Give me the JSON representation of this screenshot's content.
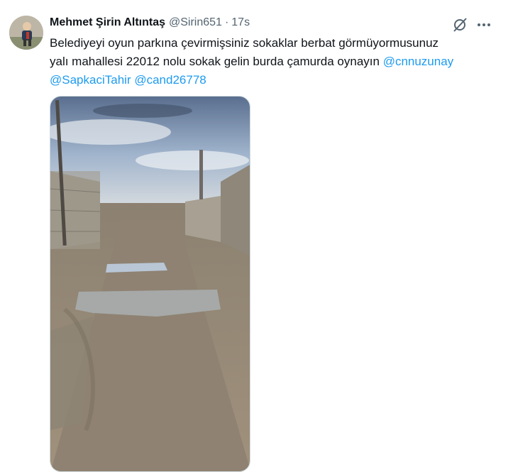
{
  "tweet": {
    "author_name": "Mehmet Şirin Altıntaş",
    "author_handle": "@Sirin651",
    "separator": "·",
    "timestamp": "17s",
    "text_line1": "Belediyeyi oyun parkına çevirmişsiniz sokaklar berbat  görmüyormusunuz",
    "text_line2": "yalı mahallesi 22012 nolu sokak gelin burda çamurda oynayın ",
    "mention1": "@cnnuzunay",
    "mention2": "@SapkaciTahir",
    "mention3": "@cand26778",
    "icons": {
      "avatar": "user-avatar",
      "grok": "grok-icon",
      "more": "more-icon"
    },
    "colors": {
      "mention": "#1d9bf0",
      "secondary_text": "#536471"
    }
  }
}
